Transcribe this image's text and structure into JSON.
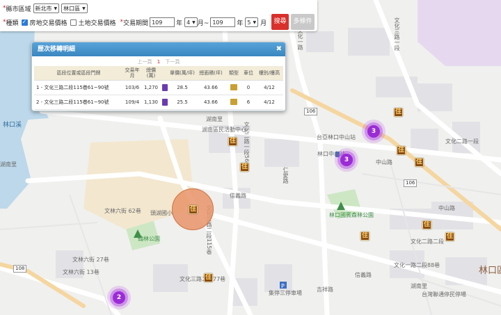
{
  "search": {
    "city_label": "縣市區域",
    "city_value": "新北市",
    "district_value": "林口區",
    "type_label": "種類",
    "type_option_1": "房地交易價格",
    "type_option_1_checked": true,
    "type_option_2": "土地交易價格",
    "type_option_2_checked": false,
    "period_label": "交易期間",
    "start_year": "109",
    "year_unit_1": "年",
    "start_month": "4",
    "month_sep": "月~",
    "end_year": "109",
    "year_unit_2": "年",
    "end_month": "5",
    "month_unit": "月",
    "search_button": "搜尋",
    "more_button": "多條件",
    "required_mark": "*"
  },
  "panel": {
    "title": "歷次移轉明細",
    "close_icon": "close-icon",
    "pager_prev": "上一頁",
    "pager_current": "1",
    "pager_next": "下一頁",
    "columns": [
      "區段位置或區段門牌",
      "交易年月",
      "總價(萬)",
      "單價(萬/坪)",
      "總面積(坪)",
      "類型",
      "車位",
      "樓別/樓高"
    ],
    "rows": [
      {
        "addr": "1 - 文化三路二段115巷61~90號",
        "date": "103/6",
        "total": "1,270",
        "unit": "28.5",
        "area": "43.66",
        "parking": "0",
        "floor": "4/12"
      },
      {
        "addr": "2 - 文化三路二段115巷61~90號",
        "date": "109/4",
        "total": "1,130",
        "unit": "25.5",
        "area": "43.66",
        "parking": "6",
        "floor": "4/12"
      }
    ]
  },
  "map": {
    "labels": {
      "lake_village": "湖南里",
      "civic_center": "湖南區民活動中心",
      "linkou_creek": "林口溪",
      "lake_village_2": "湖南里",
      "taiya_station": "台亞林口中山站",
      "zhongshan_rd": "中山路",
      "wenhua_rd_2": "文化二路一段",
      "wenhua_rd_3": "文化三路一段",
      "wenhua_rd_3b": "文化二路二段",
      "park_1": "林口國賓森林公園",
      "park_2": "翰林公園",
      "school": "頭湖國小",
      "linkou": "林口區",
      "parking": "集停三停車場",
      "lake_village_3": "湖南里",
      "taipower": "台灣聯通停民停場",
      "wenlin_6": "文林六街 62巷",
      "wenlin_7": "文林六街 27巷",
      "wenlin_13": "文林六街 13巷",
      "wenhua_77": "文化三路二段77巷",
      "wenhua_88": "文化一路二段88巷",
      "xinjiang": "信義路",
      "xinjiang_2": "信義路",
      "jifu": "吉祥路",
      "road_106": "106",
      "road_106b": "106",
      "road_108": "108",
      "cluster_1": "3",
      "cluster_2": "3",
      "cluster_3": "2",
      "house_glyph": "住",
      "road_a": "文化二路一段56巷",
      "road_b": "文化一路",
      "road_c": "文化三路二段115巷",
      "road_d": "文化三路一段",
      "road_e": "仁愛路"
    },
    "colors": {
      "cluster": "#9b2bd6",
      "house": "#8a4b12",
      "selected": "#e89468",
      "water": "#bcd8ea",
      "park": "#cde7c4",
      "school": "#f3e7cf"
    }
  }
}
